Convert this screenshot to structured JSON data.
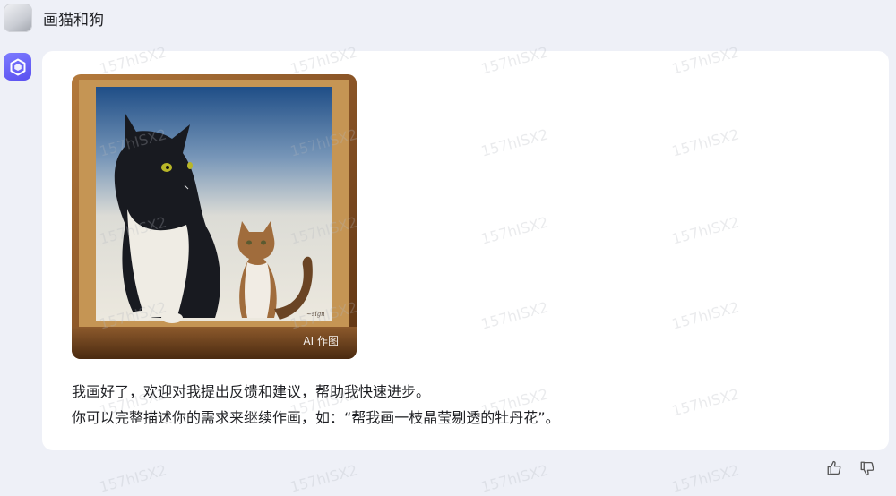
{
  "user": {
    "message": "画猫和狗"
  },
  "assistant": {
    "image_badge": "AI 作图",
    "reply_lines": [
      "我画好了，欢迎对我提出反馈和建议，帮助我快速进步。",
      "你可以完整描述你的需求来继续作画，如：“帮我画一枝晶莹剔透的牡丹花”。"
    ]
  },
  "watermark_text": "157hISX2",
  "feedback": {
    "like_icon": "thumbs-up-icon",
    "dislike_icon": "thumbs-down-icon"
  }
}
